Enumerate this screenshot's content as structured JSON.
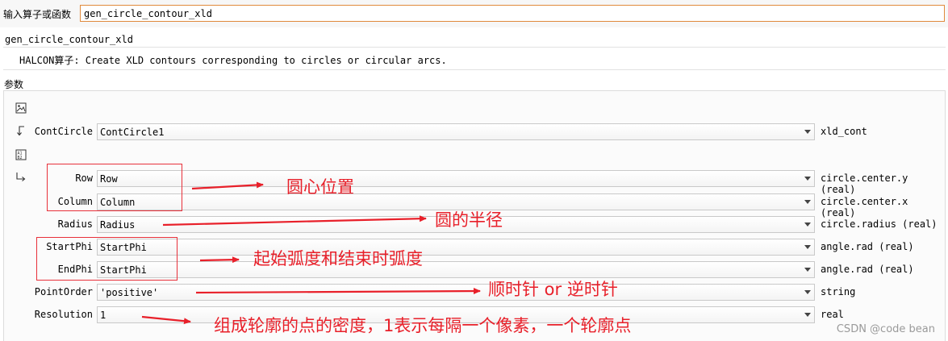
{
  "header": {
    "operator_label": "输入算子或函数",
    "operator_value": "gen_circle_contour_xld"
  },
  "operator": {
    "name": "gen_circle_contour_xld",
    "description_prefix": "HALCON算子:",
    "description": " Create XLD contours corresponding to circles or circular arcs."
  },
  "params_label": "参数",
  "output_param": {
    "label": "ContCircle",
    "value": "ContCircle1",
    "type": "xld_cont"
  },
  "input_params": [
    {
      "label": "Row",
      "value": "Row",
      "type": "circle.center.y (real)"
    },
    {
      "label": "Column",
      "value": "Column",
      "type": "circle.center.x (real)"
    },
    {
      "label": "Radius",
      "value": "Radius",
      "type": "circle.radius (real)"
    },
    {
      "label": "StartPhi",
      "value": "StartPhi",
      "type": "angle.rad (real)"
    },
    {
      "label": "EndPhi",
      "value": "StartPhi",
      "type": "angle.rad (real)"
    },
    {
      "label": "PointOrder",
      "value": "'positive'",
      "type": "string"
    },
    {
      "label": "Resolution",
      "value": "1",
      "type": "real"
    }
  ],
  "annotations": {
    "center": "圆心位置",
    "radius": "圆的半径",
    "angles": "起始弧度和结束时弧度",
    "order": "顺时针 or 逆时针",
    "resolution": "组成轮廓的点的密度，1表示每隔一个像素，一个轮廓点"
  },
  "annotation_color": "#e8202a",
  "accent_color": "#e08a3c",
  "watermark": "CSDN @code bean"
}
